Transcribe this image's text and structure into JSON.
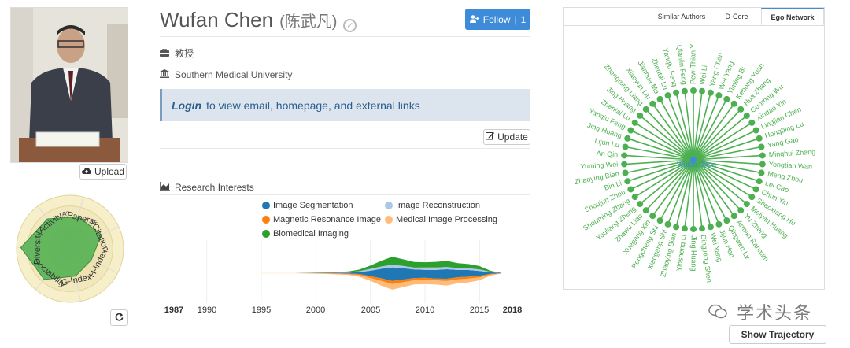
{
  "profile": {
    "name": "Wufan Chen",
    "name_cn": "(陈武凡)",
    "title": "教授",
    "affiliation": "Southern Medical University",
    "follow_label": "Follow",
    "follow_count": "1",
    "login_link": "Login",
    "login_text": "to view email, homepage, and external links",
    "update_label": "Update",
    "upload_label": "Upload"
  },
  "radar": {
    "axes": [
      "#Papers",
      "#Citation",
      "H-Index",
      "G-Index",
      "Sociability",
      "Diversity",
      "Activity"
    ],
    "values": [
      0.62,
      0.64,
      0.45,
      0.52,
      0.75,
      0.92,
      0.7
    ],
    "color": "#4caf50"
  },
  "research": {
    "title": "Research Interests",
    "legend": [
      {
        "label": "Image Segmentation",
        "color": "#1f77b4"
      },
      {
        "label": "Image Reconstruction",
        "color": "#aec7e8"
      },
      {
        "label": "Magnetic Resonance Image",
        "color": "#ff7f0e"
      },
      {
        "label": "Medical Image Processing",
        "color": "#ffbb78"
      },
      {
        "label": "Biomedical Imaging",
        "color": "#2ca02c"
      }
    ],
    "axis_start": "1987",
    "axis_end": "2018",
    "axis_ticks": [
      "1990",
      "1995",
      "2000",
      "2005",
      "2010",
      "2015"
    ]
  },
  "chart_data": {
    "type": "area",
    "title": "Research Interests",
    "x": [
      1995,
      1998,
      2001,
      2003,
      2004,
      2005,
      2006,
      2007,
      2008,
      2009,
      2010,
      2011,
      2012,
      2013,
      2014,
      2015,
      2016,
      2017
    ],
    "series": [
      {
        "name": "Image Segmentation",
        "values": [
          0,
          0,
          0.02,
          0.05,
          0.1,
          0.28,
          0.5,
          0.72,
          0.6,
          0.45,
          0.42,
          0.45,
          0.5,
          0.38,
          0.35,
          0.25,
          0.08,
          0.02
        ]
      },
      {
        "name": "Image Reconstruction",
        "values": [
          0,
          0,
          0,
          0.02,
          0.05,
          0.1,
          0.12,
          0.14,
          0.12,
          0.1,
          0.12,
          0.13,
          0.12,
          0.1,
          0.1,
          0.08,
          0.03,
          0
        ]
      },
      {
        "name": "Magnetic Resonance Image",
        "values": [
          0,
          0,
          0.02,
          0.03,
          0.05,
          0.1,
          0.14,
          0.16,
          0.14,
          0.12,
          0.12,
          0.1,
          0.12,
          0.12,
          0.1,
          0.08,
          0.03,
          0
        ]
      },
      {
        "name": "Medical Image Processing",
        "values": [
          0.01,
          0.01,
          0.03,
          0.05,
          0.1,
          0.16,
          0.25,
          0.3,
          0.26,
          0.22,
          0.22,
          0.22,
          0.24,
          0.2,
          0.2,
          0.16,
          0.06,
          0.01
        ]
      },
      {
        "name": "Biomedical Imaging",
        "values": [
          0,
          0,
          0.01,
          0.04,
          0.08,
          0.18,
          0.3,
          0.42,
          0.35,
          0.3,
          0.28,
          0.3,
          0.32,
          0.26,
          0.22,
          0.18,
          0.05,
          0
        ]
      }
    ],
    "xlim": [
      1987,
      2018
    ]
  },
  "ego": {
    "tabs": [
      "Similar Authors",
      "D-Core",
      "Ego Network"
    ],
    "active_tab": "Ego Network",
    "center": "Wufan Chen",
    "nodes": [
      "Pew-Thian Y",
      "Wei Li",
      "Yang Chen",
      "Wei Yang",
      "Yiming Bi",
      "Kehong Yuan",
      "Hua Zhang",
      "Guorong Wu",
      "Xindao Yin",
      "Lingjian Chen",
      "Hongbing Lu",
      "Yang Gao",
      "Minghui Zhang",
      "Yongtian Wan",
      "Meng Zhou",
      "Lei Cao",
      "Chun Yin",
      "Shaoxiang Hu",
      "Meiyan Huang",
      "Yu Zhang",
      "Arman Rahmim",
      "Qingwen Lv",
      "Jijun Han",
      "Wei Yang",
      "Dingjiong Shen",
      "Jing Huang",
      "Yinsheng Li",
      "Zhaoying Bian",
      "Xiaogang Shi",
      "Pengcheng Shi",
      "Xuegang Xin",
      "Zhawu Liao",
      "Youliang Zheng",
      "Shouming Zhang",
      "Shoujun Zhou",
      "Bin Li",
      "Zhaoying Bian",
      "Yuming Wei",
      "An Qin",
      "Lijun Lu",
      "Jing Huang",
      "Yanqiu Feng",
      "Zhentai Lu",
      "Jing Huang",
      "Zhengrong Liang",
      "Xiaoyun Liu",
      "Jianhua Ma",
      "Zhentai Lu",
      "Yanqiu Feng",
      "Qianjin Feng"
    ],
    "node_color": "#4caf50",
    "show_trajectory_label": "Show Trajectory"
  },
  "watermark": "学术头条"
}
